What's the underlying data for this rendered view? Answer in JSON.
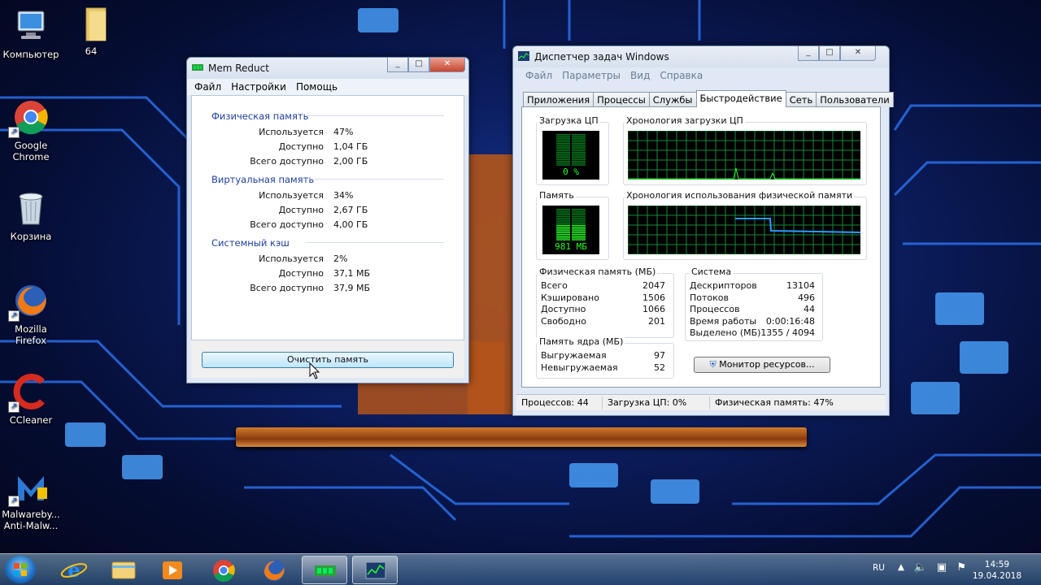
{
  "desktop": {
    "icons": [
      {
        "label": "Компьютер",
        "icon": "computer-icon"
      },
      {
        "label": "64",
        "icon": "folder-icon"
      },
      {
        "label": "Google Chrome",
        "icon": "chrome-icon"
      },
      {
        "label": "Корзина",
        "icon": "recycle-bin-icon"
      },
      {
        "label": "Mozilla Firefox",
        "icon": "firefox-icon"
      },
      {
        "label": "CCleaner",
        "icon": "ccleaner-icon"
      },
      {
        "label": "Malwareby... Anti-Malw...",
        "icon": "malwarebytes-icon"
      }
    ]
  },
  "memreduct": {
    "title": "Mem Reduct",
    "menu": [
      "Файл",
      "Настройки",
      "Помощь"
    ],
    "groups": [
      {
        "title": "Физическая память",
        "rows": [
          {
            "label": "Используется",
            "value": "47%"
          },
          {
            "label": "Доступно",
            "value": "1,04 ГБ"
          },
          {
            "label": "Всего доступно",
            "value": "2,00 ГБ"
          }
        ]
      },
      {
        "title": "Виртуальная память",
        "rows": [
          {
            "label": "Используется",
            "value": "34%"
          },
          {
            "label": "Доступно",
            "value": "2,67 ГБ"
          },
          {
            "label": "Всего доступно",
            "value": "4,00 ГБ"
          }
        ]
      },
      {
        "title": "Системный кэш",
        "rows": [
          {
            "label": "Используется",
            "value": "2%"
          },
          {
            "label": "Доступно",
            "value": "37,1 МБ"
          },
          {
            "label": "Всего доступно",
            "value": "37,9 МБ"
          }
        ]
      }
    ],
    "clean_button": "Очистить память"
  },
  "taskmgr": {
    "title": "Диспетчер задач Windows",
    "menu": [
      "Файл",
      "Параметры",
      "Вид",
      "Справка"
    ],
    "tabs": [
      "Приложения",
      "Процессы",
      "Службы",
      "Быстродействие",
      "Сеть",
      "Пользователи"
    ],
    "active_tab": "Быстродействие",
    "cpu_title": "Загрузка ЦП",
    "cpu_value": "0 %",
    "cpu_history_title": "Хронология загрузки ЦП",
    "mem_title": "Память",
    "mem_value": "981 МБ",
    "mem_history_title": "Хронология использования физической памяти",
    "phys_title": "Физическая память (МБ)",
    "phys_rows": [
      {
        "label": "Всего",
        "value": "2047"
      },
      {
        "label": "Кэшировано",
        "value": "1506"
      },
      {
        "label": "Доступно",
        "value": "1066"
      },
      {
        "label": "Свободно",
        "value": "201"
      }
    ],
    "kernel_title": "Память ядра (МБ)",
    "kernel_rows": [
      {
        "label": "Выгружаемая",
        "value": "97"
      },
      {
        "label": "Невыгружаемая",
        "value": "52"
      }
    ],
    "system_title": "Система",
    "system_rows": [
      {
        "label": "Дескрипторов",
        "value": "13104"
      },
      {
        "label": "Потоков",
        "value": "496"
      },
      {
        "label": "Процессов",
        "value": "44"
      },
      {
        "label": "Время работы",
        "value": "0:00:16:48"
      },
      {
        "label": "Выделено (МБ)",
        "value": "1355 / 4094"
      }
    ],
    "resource_button": "Монитор ресурсов...",
    "status": {
      "processes": "Процессов: 44",
      "cpu": "Загрузка ЦП: 0%",
      "memory": "Физическая память: 47%"
    }
  },
  "taskbar": {
    "language": "RU",
    "time": "14:59",
    "date": "19.04.2018"
  },
  "colors": {
    "graph_grid": "#138a3a",
    "graph_line": "#2aff2a",
    "mem_line": "#2a9dff",
    "group_title": "#1d3f9a"
  }
}
